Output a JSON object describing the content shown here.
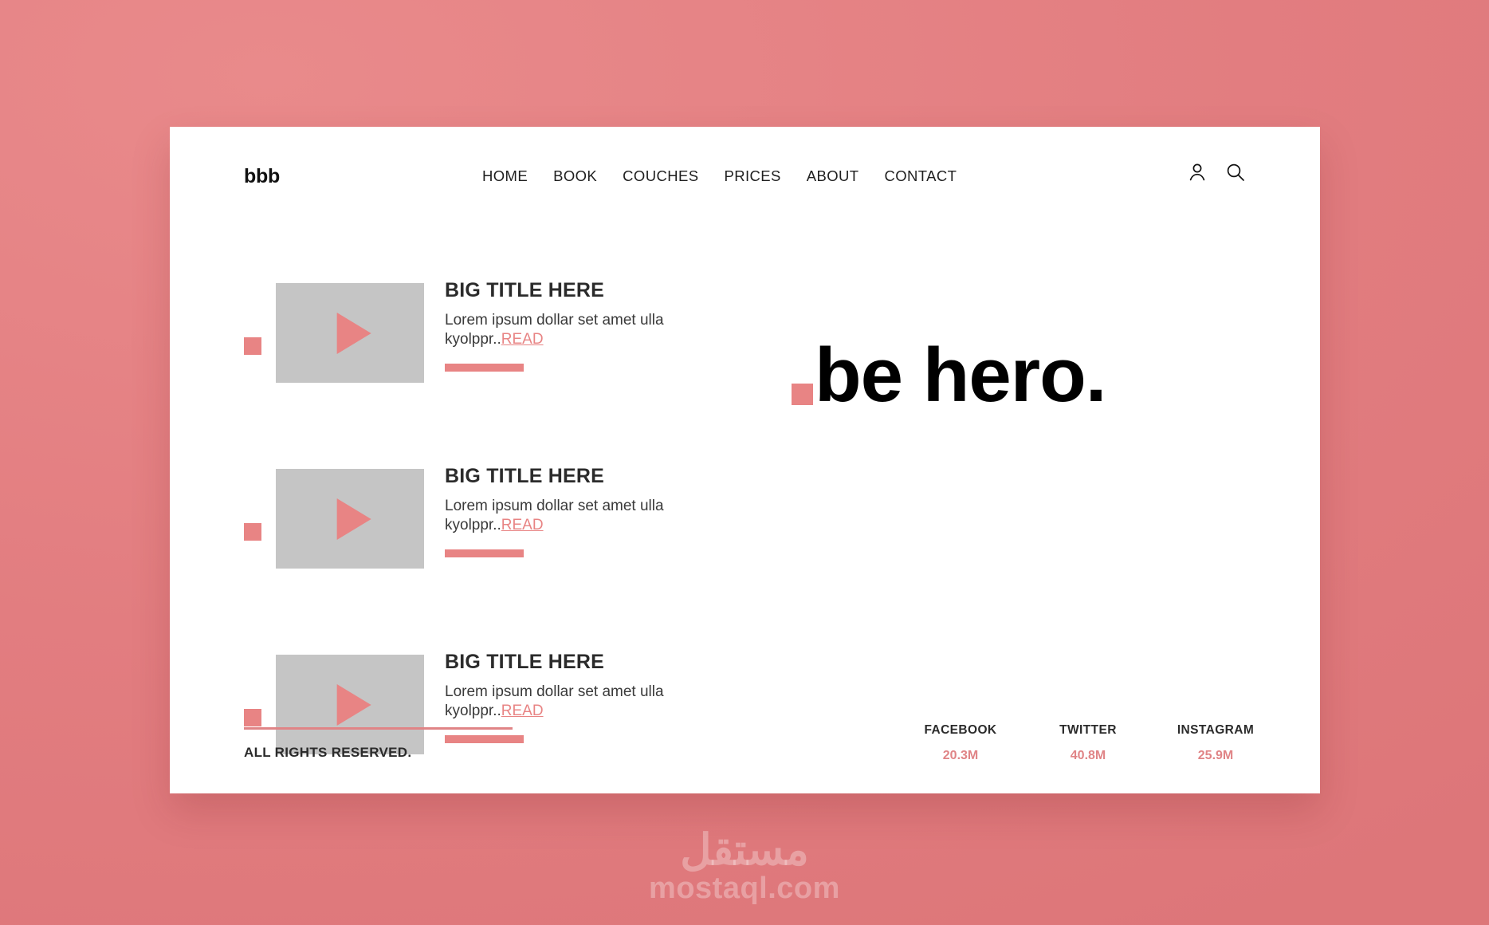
{
  "theme": {
    "accent": "#e88484",
    "background": "#e27d80",
    "card_background": "#ffffff",
    "thumbnail_gray": "#c5c5c5",
    "text_dark": "#2b2b2b"
  },
  "nav": {
    "logo": "bbb",
    "items": [
      {
        "label": "HOME"
      },
      {
        "label": "BOOK"
      },
      {
        "label": "COUCHES"
      },
      {
        "label": "PRICES"
      },
      {
        "label": "ABOUT"
      },
      {
        "label": "CONTACT"
      }
    ],
    "icons": [
      {
        "name": "user-icon"
      },
      {
        "name": "search-icon"
      }
    ]
  },
  "cards": [
    {
      "title": "BIG TITLE HERE",
      "desc": "Lorem ipsum dollar set amet ulla kyolppr..",
      "read_label": "READ",
      "play_icon": "play-icon"
    },
    {
      "title": "BIG TITLE HERE",
      "desc": "Lorem ipsum dollar set amet ulla kyolppr..",
      "read_label": "READ",
      "play_icon": "play-icon"
    },
    {
      "title": "BIG TITLE HERE",
      "desc": "Lorem ipsum dollar set amet ulla kyolppr..",
      "read_label": "READ",
      "play_icon": "play-icon"
    }
  ],
  "hero": {
    "dot": "square-dot",
    "text": "be hero."
  },
  "footer": {
    "copyright": "ALL RIGHTS RESERVED.",
    "socials": [
      {
        "name": "FACEBOOK",
        "count": "20.3M"
      },
      {
        "name": "TWITTER",
        "count": "40.8M"
      },
      {
        "name": "INSTAGRAM",
        "count": "25.9M"
      }
    ]
  },
  "watermark": {
    "arabic": "مستقل",
    "latin": "mostaql.com"
  }
}
